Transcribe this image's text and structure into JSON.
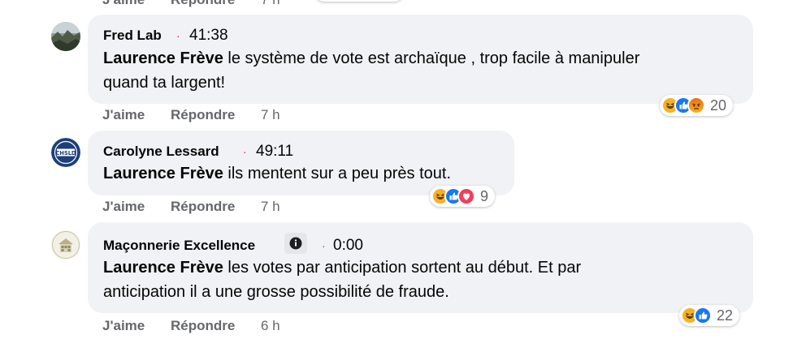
{
  "top_partial": {
    "like": "J'aime",
    "reply": "Répondre",
    "age": "7 h"
  },
  "comments": [
    {
      "author": "Fred Lab",
      "timestamp": "41:38",
      "mention": "Laurence Frève",
      "text_line1": " le système de vote est archaïque , trop facile à manipuler",
      "text_line2": "quand ta largent!",
      "like": "J'aime",
      "reply": "Répondre",
      "age": "7 h",
      "reactions": [
        "haha",
        "like",
        "angry"
      ],
      "reaction_count": "20"
    },
    {
      "author": "Carolyne Lessard",
      "timestamp": "49:11",
      "mention": "Laurence Frève",
      "text_line1": " ils mentent sur a peu près tout.",
      "like": "J'aime",
      "reply": "Répondre",
      "age": "7 h",
      "avatar_text": "CHSLD",
      "reactions": [
        "haha",
        "like",
        "love"
      ],
      "reaction_count": "9"
    },
    {
      "author": "Maçonnerie Excellence",
      "timestamp": "0:00",
      "mention": "Laurence Frève",
      "text_line1": " les votes par anticipation sortent au début. Et par",
      "text_line2": "anticipation il a une grosse possibilité de fraude.",
      "like": "J'aime",
      "reply": "Répondre",
      "age": "6 h",
      "reactions": [
        "haha",
        "like"
      ],
      "reaction_count": "22"
    }
  ],
  "colors": {
    "bubble": "#f0f2f5",
    "meta": "#65676b",
    "accent_dot": "#e41e3f",
    "like_blue": "#1877f2",
    "haha_yellow": "#f7b125",
    "love_red": "#f33e58",
    "angry_orange": "#e9710f"
  }
}
